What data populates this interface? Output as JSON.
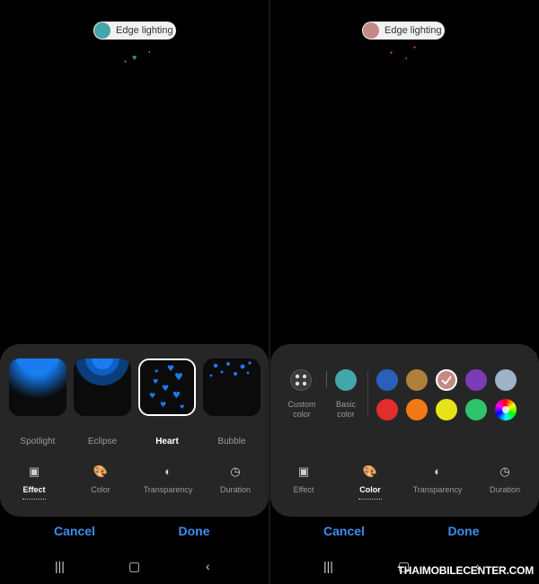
{
  "left_screen": {
    "pill": {
      "label": "Edge lighting",
      "dot_color": "#43a6a8"
    },
    "effects": [
      {
        "label": "Spotlight",
        "icon": "spotlight-preview"
      },
      {
        "label": "Eclipse",
        "icon": "eclipse-preview"
      },
      {
        "label": "Heart",
        "icon": "heart-preview",
        "selected": true
      },
      {
        "label": "Bubble",
        "icon": "bubble-preview"
      }
    ],
    "tabs": [
      {
        "label": "Effect",
        "icon": "effect-icon",
        "active": true
      },
      {
        "label": "Color",
        "icon": "palette-icon"
      },
      {
        "label": "Transparency",
        "icon": "transparency-icon"
      },
      {
        "label": "Duration",
        "icon": "clock-icon"
      }
    ],
    "cancel": "Cancel",
    "done": "Done"
  },
  "right_screen": {
    "pill": {
      "label": "Edge lighting",
      "dot_color": "#c58a86"
    },
    "custom_color_label": "Custom color",
    "basic_color_label": "Basic color",
    "basic_color": "#43a6a8",
    "colors_row1": [
      "#2b5fbd",
      "#b07f3a",
      "#c58a86",
      "#7b3bb7",
      "#9db3c8"
    ],
    "colors_row2": [
      "#e32c2c",
      "#f07817",
      "#e6e319",
      "#2ec46b",
      "rainbow"
    ],
    "selected_color": "#c58a86",
    "tabs": [
      {
        "label": "Effect",
        "icon": "effect-icon"
      },
      {
        "label": "Color",
        "icon": "palette-icon",
        "active": true
      },
      {
        "label": "Transparency",
        "icon": "transparency-icon"
      },
      {
        "label": "Duration",
        "icon": "clock-icon"
      }
    ],
    "cancel": "Cancel",
    "done": "Done"
  },
  "watermark": "THAIMOBILECENTER.COM",
  "colors": {
    "accent": "#3d8ef0",
    "panel": "#262626",
    "glow": "#1a7cf0"
  }
}
